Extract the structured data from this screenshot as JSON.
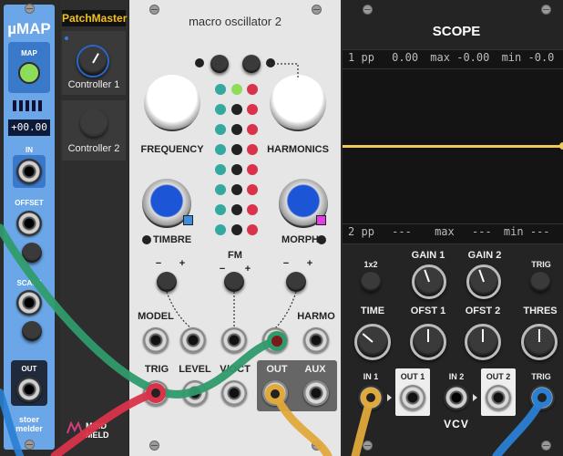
{
  "umap": {
    "title": "µMAP",
    "map_label": "MAP",
    "value": "+00.00",
    "in_label": "IN",
    "offset_label": "OFFSET",
    "scale_label": "SCALE",
    "out_label": "OUT",
    "brand": "stoer melder"
  },
  "patchmaster": {
    "title": "PatchMaster",
    "controller1": "Controller 1",
    "controller2": "Controller 2",
    "brand": "MIND MELD"
  },
  "macro": {
    "title": "macro oscillator 2",
    "frequency": "FREQUENCY",
    "harmonics": "HARMONICS",
    "timbre": "TIMBRE",
    "morph": "MORPH",
    "fm": "FM",
    "model": "MODEL",
    "harmo": "HARMO",
    "trig": "TRIG",
    "level": "LEVEL",
    "voct": "V/OCT",
    "out": "OUT",
    "aux": "AUX",
    "minus": "−",
    "plus": "+"
  },
  "scope": {
    "title": "SCOPE",
    "row1": {
      "ch": "1",
      "pp": "pp",
      "pp_val": "0.00",
      "max": "max",
      "max_val": "-0.00",
      "min": "min",
      "min_val": "-0.0"
    },
    "row2": {
      "ch": "2",
      "pp": "pp",
      "pp_val": "---",
      "max": "max",
      "max_val": "---",
      "min": "min",
      "min_val": "---"
    },
    "x2": "1x2",
    "gain1": "GAIN 1",
    "gain2": "GAIN 2",
    "trig": "TRIG",
    "time": "TIME",
    "ofst1": "OFST 1",
    "ofst2": "OFST 2",
    "thres": "THRES",
    "in1": "IN 1",
    "out1": "OUT 1",
    "in2": "IN 2",
    "out2": "OUT 2",
    "trig_in": "TRIG",
    "brand": "VCV"
  },
  "colors": {
    "umap_blue": "#6aa6e8",
    "led_green": "#8fdc5a",
    "knob_blue": "#1c55d6",
    "cable_green": "#2f9b6c",
    "cable_red": "#d9334a",
    "cable_yellow": "#e0a93a",
    "cable_blue": "#2a7fd2",
    "trace_yellow": "#f0c95a"
  }
}
